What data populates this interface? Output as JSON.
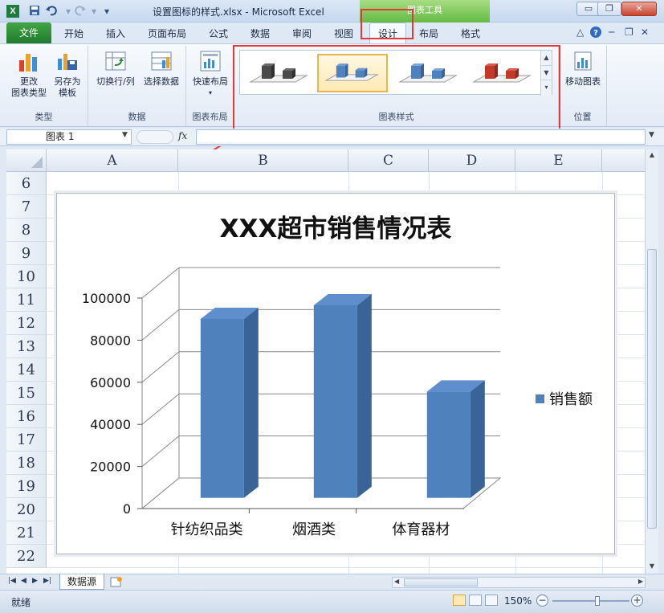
{
  "window": {
    "title": "设置图标的样式.xlsx  -  Microsoft Excel",
    "app_icon": "X",
    "chart_tools_label": "图表工具",
    "minimize": "▭",
    "restore": "❐",
    "close": "✕"
  },
  "qat": {
    "save_icon": "save-icon",
    "undo_icon": "undo-icon",
    "redo_icon": "redo-icon"
  },
  "tabs": {
    "file": "文件",
    "items": [
      "开始",
      "插入",
      "页面布局",
      "公式",
      "数据",
      "审阅",
      "视图",
      "设计",
      "布局",
      "格式"
    ],
    "active": "设计"
  },
  "ribbon": {
    "groups": {
      "type": {
        "label": "类型",
        "buttons": [
          "更改\n图表类型",
          "另存为\n模板"
        ]
      },
      "data": {
        "label": "数据",
        "buttons": [
          "切换行/列",
          "选择数据"
        ]
      },
      "layout": {
        "label": "图表布局",
        "buttons": [
          "快速布局"
        ]
      },
      "styles": {
        "label": "图表样式",
        "selected_index": 1
      },
      "location": {
        "label": "位置",
        "buttons": [
          "移动图表"
        ]
      }
    }
  },
  "formula_bar": {
    "name_box": "图表 1",
    "fx": "fx",
    "content": ""
  },
  "grid": {
    "columns": [
      "A",
      "B",
      "C",
      "D",
      "E"
    ],
    "rows": [
      "6",
      "7",
      "8",
      "9",
      "10",
      "11",
      "12",
      "13",
      "14",
      "15",
      "16",
      "17",
      "18",
      "19",
      "20",
      "21",
      "22"
    ]
  },
  "chart_data": {
    "type": "bar",
    "title": "XXX超市销售情况表",
    "categories": [
      "针纺织品类",
      "烟酒类",
      "体育器材"
    ],
    "series": [
      {
        "name": "销售额",
        "values": [
          85000,
          91500,
          50500
        ],
        "color": "#4f81bd"
      }
    ],
    "yticks": [
      "0",
      "20000",
      "40000",
      "60000",
      "80000",
      "100000"
    ],
    "ylim": [
      0,
      100000
    ],
    "grid": true,
    "legend": "right",
    "style": "3d-column"
  },
  "sheets": {
    "tabs": [
      "数据源"
    ],
    "active": "数据源"
  },
  "status": {
    "ready": "就绪",
    "zoom": "150%",
    "zoom_value": 150
  },
  "colors": {
    "accent": "#2b7d35",
    "selection_red": "#e23a3a",
    "bar": "#4f81bd",
    "bar_side": "#3a6497",
    "bar_top": "#5e8fcc"
  }
}
